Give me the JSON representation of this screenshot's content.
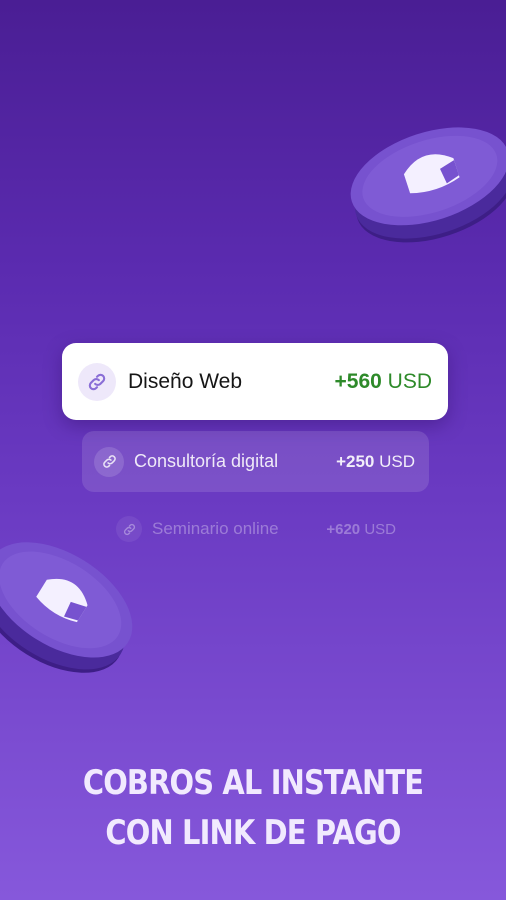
{
  "payments": [
    {
      "title": "Diseño Web",
      "amount": "+560",
      "currency": "USD",
      "icon": "link-icon"
    },
    {
      "title": "Consultoría digital",
      "amount": "+250",
      "currency": "USD",
      "icon": "link-icon"
    },
    {
      "title": "Seminario online",
      "amount": "+620",
      "currency": "USD",
      "icon": "link-icon"
    }
  ],
  "headline": {
    "line1": "COBROS AL INSTANTE",
    "line2": "CON LINK DE PAGO"
  },
  "colors": {
    "background_top": "#4a1e94",
    "background_bottom": "#8658db",
    "amount_positive": "#2e8a2a",
    "coin": "#6b46c8"
  }
}
